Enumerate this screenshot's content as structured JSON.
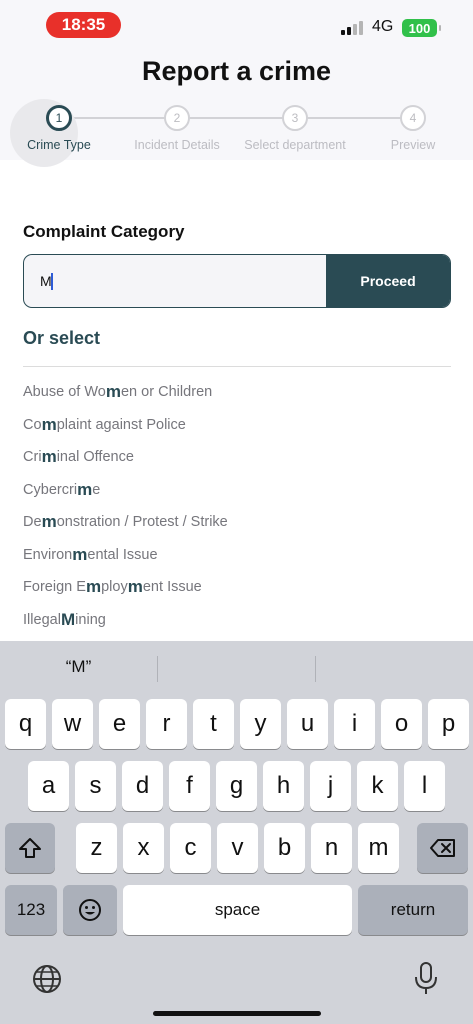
{
  "status_bar": {
    "time": "18:35",
    "network": "4G",
    "battery": "100"
  },
  "header": {
    "title": "Report a crime",
    "steps": [
      {
        "number": "1",
        "label": "Crime Type",
        "active": true
      },
      {
        "number": "2",
        "label": "Incident Details",
        "active": false
      },
      {
        "number": "3",
        "label": "Select department",
        "active": false
      },
      {
        "number": "4",
        "label": "Preview",
        "active": false
      }
    ]
  },
  "form": {
    "section_title": "Complaint Category",
    "search_value": "M",
    "proceed_label": "Proceed",
    "or_select_label": "Or select",
    "categories": [
      {
        "label": "Abuse of Women or Children"
      },
      {
        "label": "Complaint against Police"
      },
      {
        "label": "Criminal Offence"
      },
      {
        "label": "Cybercrime"
      },
      {
        "label": "Demonstration / Protest / Strike"
      },
      {
        "label": "Environmental Issue"
      },
      {
        "label": "Foreign Employment Issue"
      },
      {
        "label": "Illegal Mining"
      }
    ],
    "highlight_letter": "m"
  },
  "keyboard": {
    "suggestions": [
      "“M”",
      "",
      ""
    ],
    "row1": [
      "q",
      "w",
      "e",
      "r",
      "t",
      "y",
      "u",
      "i",
      "o",
      "p"
    ],
    "row2": [
      "a",
      "s",
      "d",
      "f",
      "g",
      "h",
      "j",
      "k",
      "l"
    ],
    "row3": [
      "z",
      "x",
      "c",
      "v",
      "b",
      "n",
      "m"
    ],
    "numbers_label": "123",
    "space_label": "space",
    "return_label": "return",
    "icons": {
      "shift": "shift-icon",
      "backspace": "backspace-icon",
      "emoji": "emoji-icon",
      "globe": "globe-icon",
      "mic": "microphone-icon"
    }
  },
  "colors": {
    "accent": "#2a4b54",
    "time_pill": "#e8302a",
    "battery": "#31c04a"
  }
}
